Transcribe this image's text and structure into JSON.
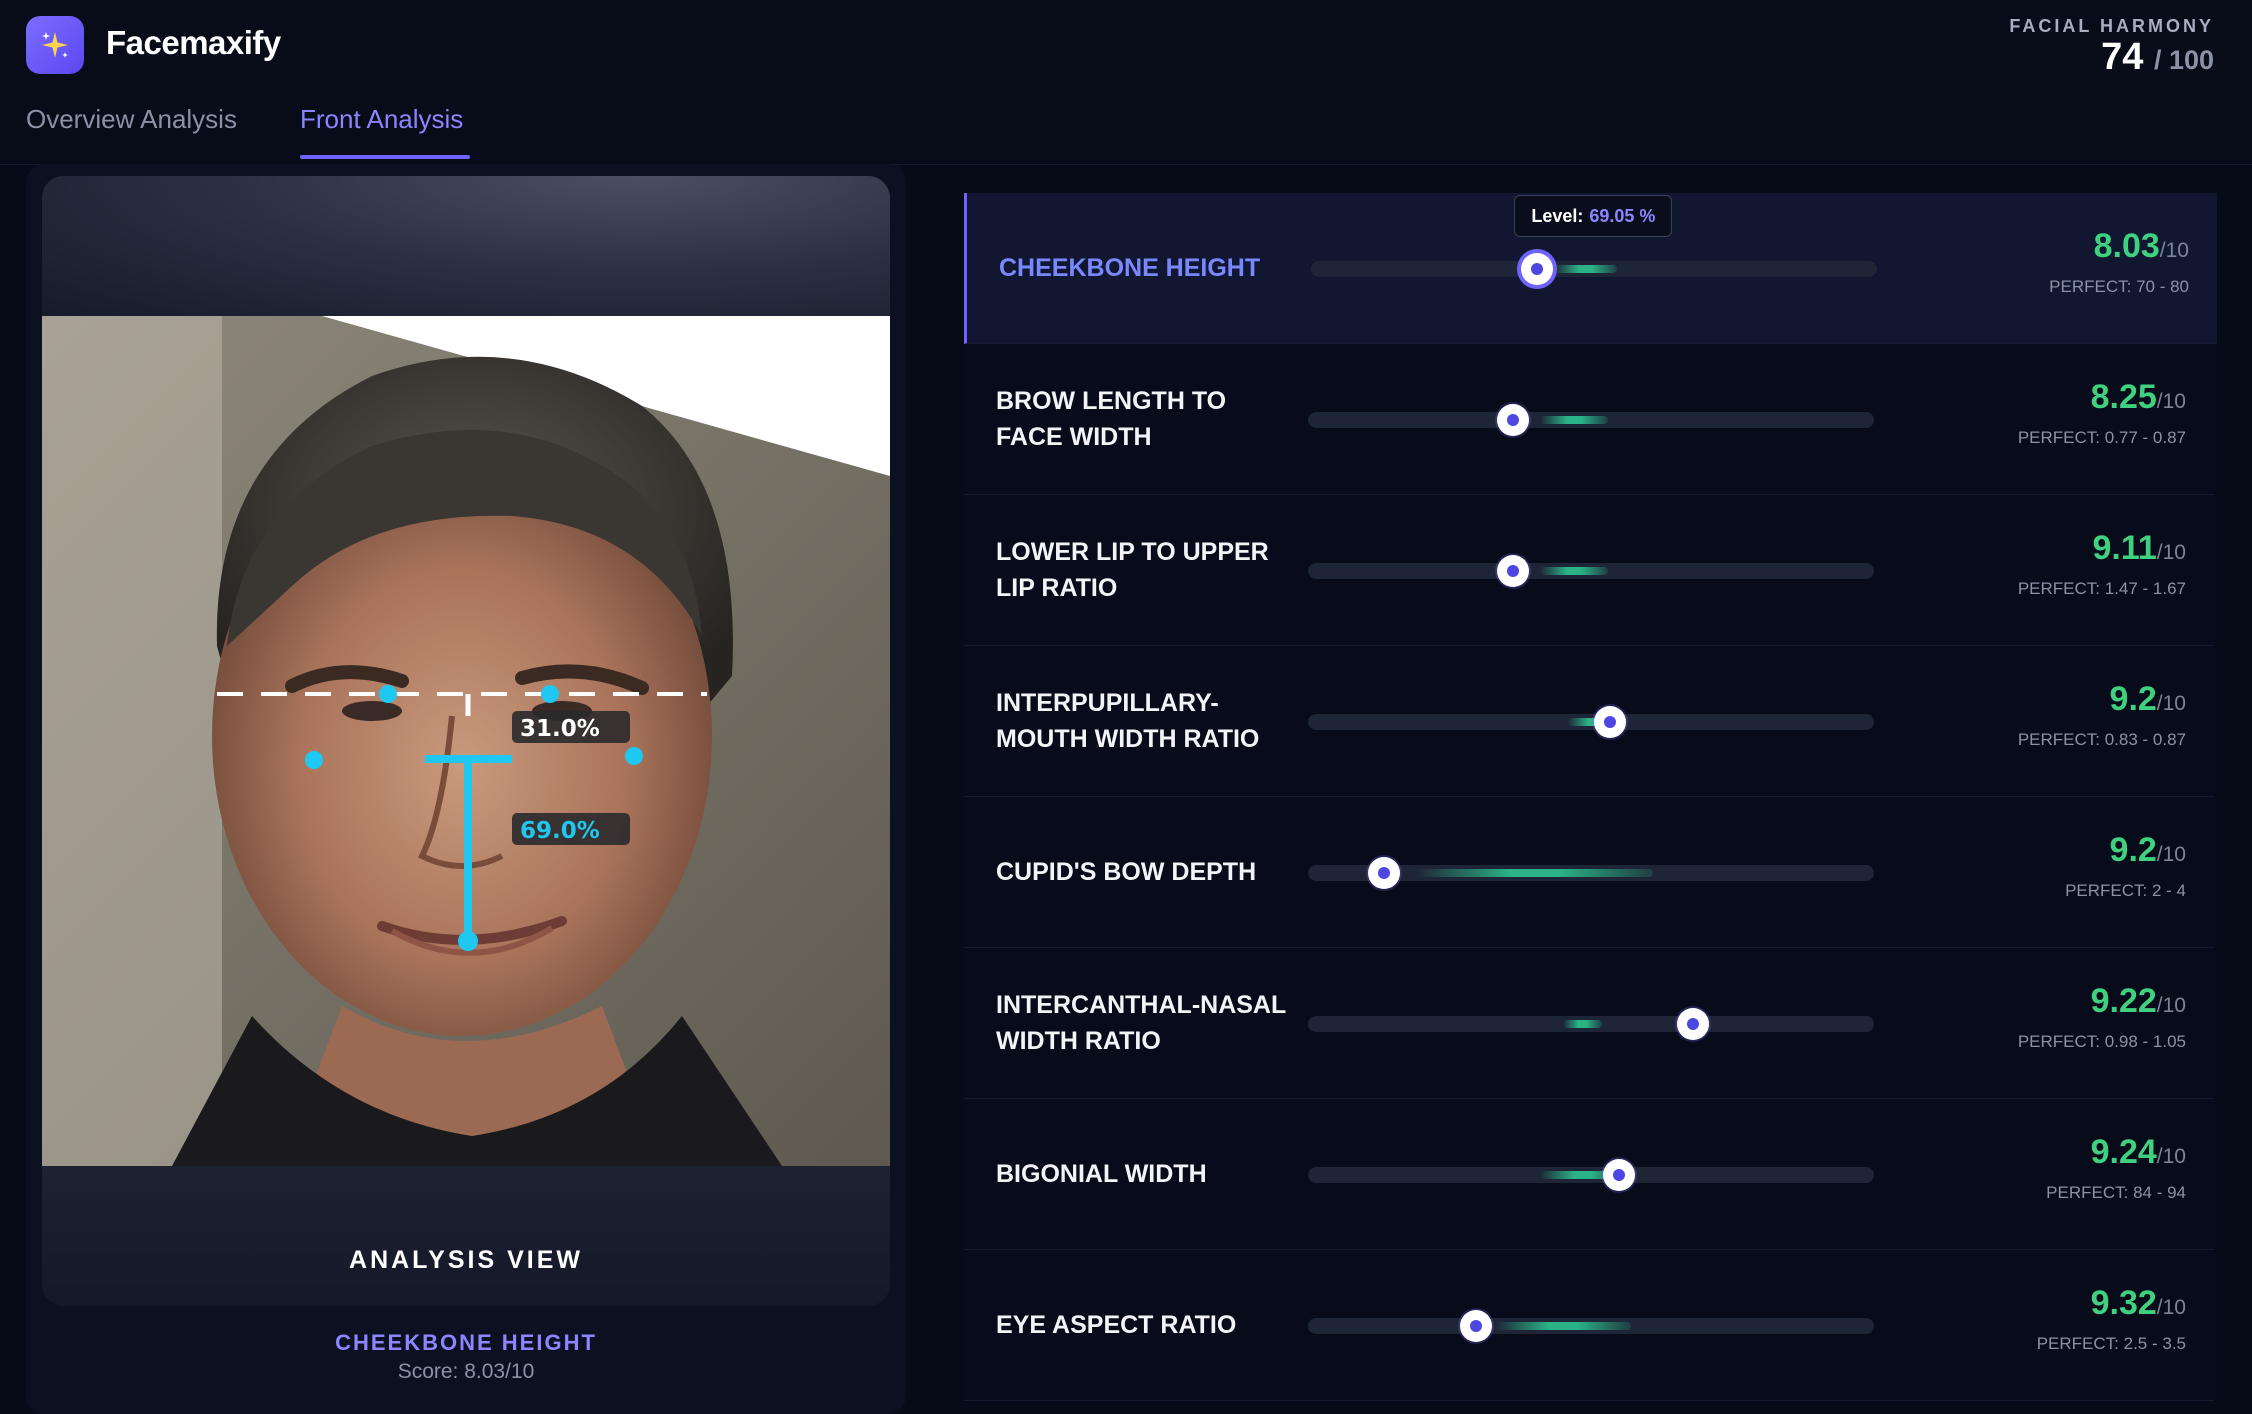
{
  "app": {
    "name": "Facemaxify",
    "logo_icon": "sparkle-icon"
  },
  "tabs": [
    {
      "label": "Overview Analysis",
      "active": false
    },
    {
      "label": "Front Analysis",
      "active": true
    }
  ],
  "harmony": {
    "label": "FACIAL HARMONY",
    "score": "74",
    "max": "/ 100"
  },
  "image_card": {
    "overlay_upper": "31.0%",
    "overlay_lower": "69.0%",
    "caption": "ANALYSIS VIEW"
  },
  "selected_metric": {
    "title": "CHEEKBONE HEIGHT",
    "score": "Score: 8.03/10"
  },
  "metrics": [
    {
      "label": "CHEEKBONE HEIGHT",
      "score": "8.03",
      "den": "/10",
      "perfect": "PERFECT: 70 - 80",
      "level": 0.4,
      "ideal": [
        0.43,
        0.54
      ],
      "active": true,
      "tooltip_label": "Level:",
      "tooltip_value": "69.05 %"
    },
    {
      "label": "BROW LENGTH TO FACE WIDTH",
      "score": "8.25",
      "den": "/10",
      "perfect": "PERFECT: 0.77 - 0.87",
      "level": 0.363,
      "ideal": [
        0.41,
        0.53
      ]
    },
    {
      "label": "LOWER LIP TO UPPER LIP RATIO",
      "score": "9.11",
      "den": "/10",
      "perfect": "PERFECT: 1.47 - 1.67",
      "level": 0.363,
      "ideal": [
        0.41,
        0.53
      ]
    },
    {
      "label": "INTERPUPILLARY-MOUTH WIDTH RATIO",
      "score": "9.2",
      "den": "/10",
      "perfect": "PERFECT: 0.83 - 0.87",
      "level": 0.533,
      "ideal": [
        0.46,
        0.55
      ]
    },
    {
      "label": "CUPID'S BOW DEPTH",
      "score": "9.2",
      "den": "/10",
      "perfect": "PERFECT: 2 - 4",
      "level": 0.135,
      "ideal": [
        0.19,
        0.61
      ]
    },
    {
      "label": "INTERCANTHAL-NASAL WIDTH RATIO",
      "score": "9.22",
      "den": "/10",
      "perfect": "PERFECT: 0.98 - 1.05",
      "level": 0.68,
      "ideal": [
        0.45,
        0.52
      ]
    },
    {
      "label": "BIGONIAL WIDTH",
      "score": "9.24",
      "den": "/10",
      "perfect": "PERFECT: 84 - 94",
      "level": 0.55,
      "ideal": [
        0.41,
        0.56
      ]
    },
    {
      "label": "EYE ASPECT RATIO",
      "score": "9.32",
      "den": "/10",
      "perfect": "PERFECT: 2.5 - 3.5",
      "level": 0.297,
      "ideal": [
        0.33,
        0.57
      ]
    }
  ],
  "colors": {
    "accent": "#6f63ff",
    "good": "#3fd17f",
    "overlay": "#1ec8f0"
  }
}
